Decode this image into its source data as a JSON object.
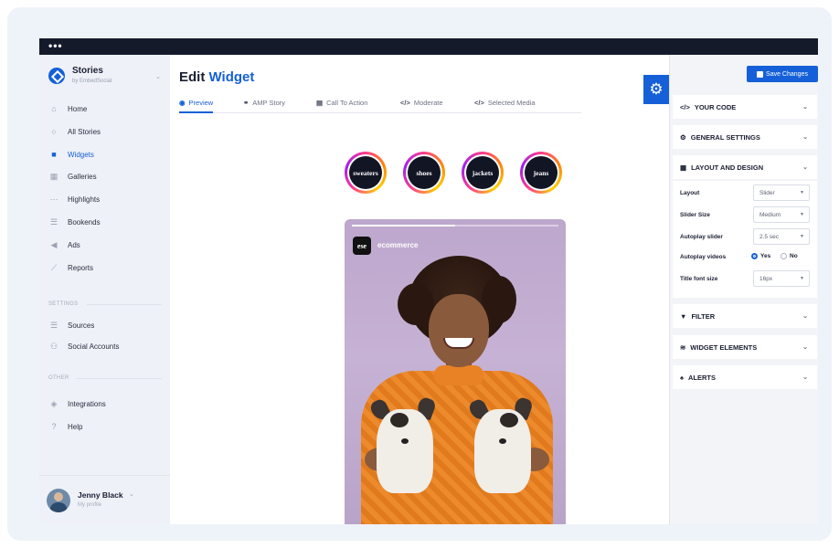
{
  "window": {
    "dots": "•••"
  },
  "sidebar": {
    "brand": {
      "title": "Stories",
      "subtitle": "by EmbedSocial"
    },
    "items": [
      {
        "label": "Home",
        "icon": "home-icon",
        "glyph": "⌂"
      },
      {
        "label": "All Stories",
        "icon": "circle-icon",
        "glyph": "○"
      },
      {
        "label": "Widgets",
        "icon": "grid-icon",
        "glyph": "■"
      },
      {
        "label": "Galleries",
        "icon": "gallery-icon",
        "glyph": "▦"
      },
      {
        "label": "Highlights",
        "icon": "dots-icon",
        "glyph": "⋯"
      },
      {
        "label": "Bookends",
        "icon": "list-icon",
        "glyph": "☰"
      },
      {
        "label": "Ads",
        "icon": "megaphone-icon",
        "glyph": "◀"
      },
      {
        "label": "Reports",
        "icon": "chart-icon",
        "glyph": "⟋"
      }
    ],
    "settings_label": "SETTINGS",
    "settings_items": [
      {
        "label": "Sources",
        "icon": "sources-icon",
        "glyph": "☰"
      },
      {
        "label": "Social Accounts",
        "icon": "accounts-icon",
        "glyph": "⚇"
      }
    ],
    "other_label": "OTHER",
    "other_items": [
      {
        "label": "Integrations",
        "icon": "integrations-icon",
        "glyph": "◈"
      },
      {
        "label": "Help",
        "icon": "help-icon",
        "glyph": "?"
      }
    ],
    "profile": {
      "name": "Jenny Black",
      "subtitle": "My profile"
    }
  },
  "main": {
    "title_prefix": "Edit",
    "title_accent": "Widget",
    "tabs": [
      {
        "label": "Preview",
        "glyph": "◉"
      },
      {
        "label": "AMP Story",
        "glyph": "⚭"
      },
      {
        "label": "Call To Action",
        "glyph": "▤"
      },
      {
        "label": "Moderate",
        "glyph": "</>"
      },
      {
        "label": "Selected Media",
        "glyph": "</>"
      }
    ],
    "bubbles": [
      "sweaters",
      "shoes",
      "jackets",
      "jeans"
    ],
    "story": {
      "badge": "ese",
      "name": "ecommerce",
      "progress": 0.5
    }
  },
  "panel": {
    "save_label": "Save Changes",
    "sections": {
      "your_code": "YOUR CODE",
      "general": "GENERAL SETTINGS",
      "layout": "LAYOUT AND DESIGN",
      "filter": "FILTER",
      "widget_elements": "WIDGET ELEMENTS",
      "alerts": "ALERTS"
    },
    "layout_fields": {
      "layout": {
        "label": "Layout",
        "value": "Slider"
      },
      "slider_size": {
        "label": "Slider Size",
        "value": "Medium"
      },
      "autoplay_slider": {
        "label": "Autoplay slider",
        "value": "2.5 sec"
      },
      "autoplay_videos": {
        "label": "Autoplay videos",
        "yes": "Yes",
        "no": "No",
        "selected": "Yes"
      },
      "title_font": {
        "label": "Title font size",
        "value": "16px"
      }
    }
  },
  "colors": {
    "accent": "#1560d8",
    "topbar": "#151a2b",
    "sidebar": "#eef1f7"
  }
}
